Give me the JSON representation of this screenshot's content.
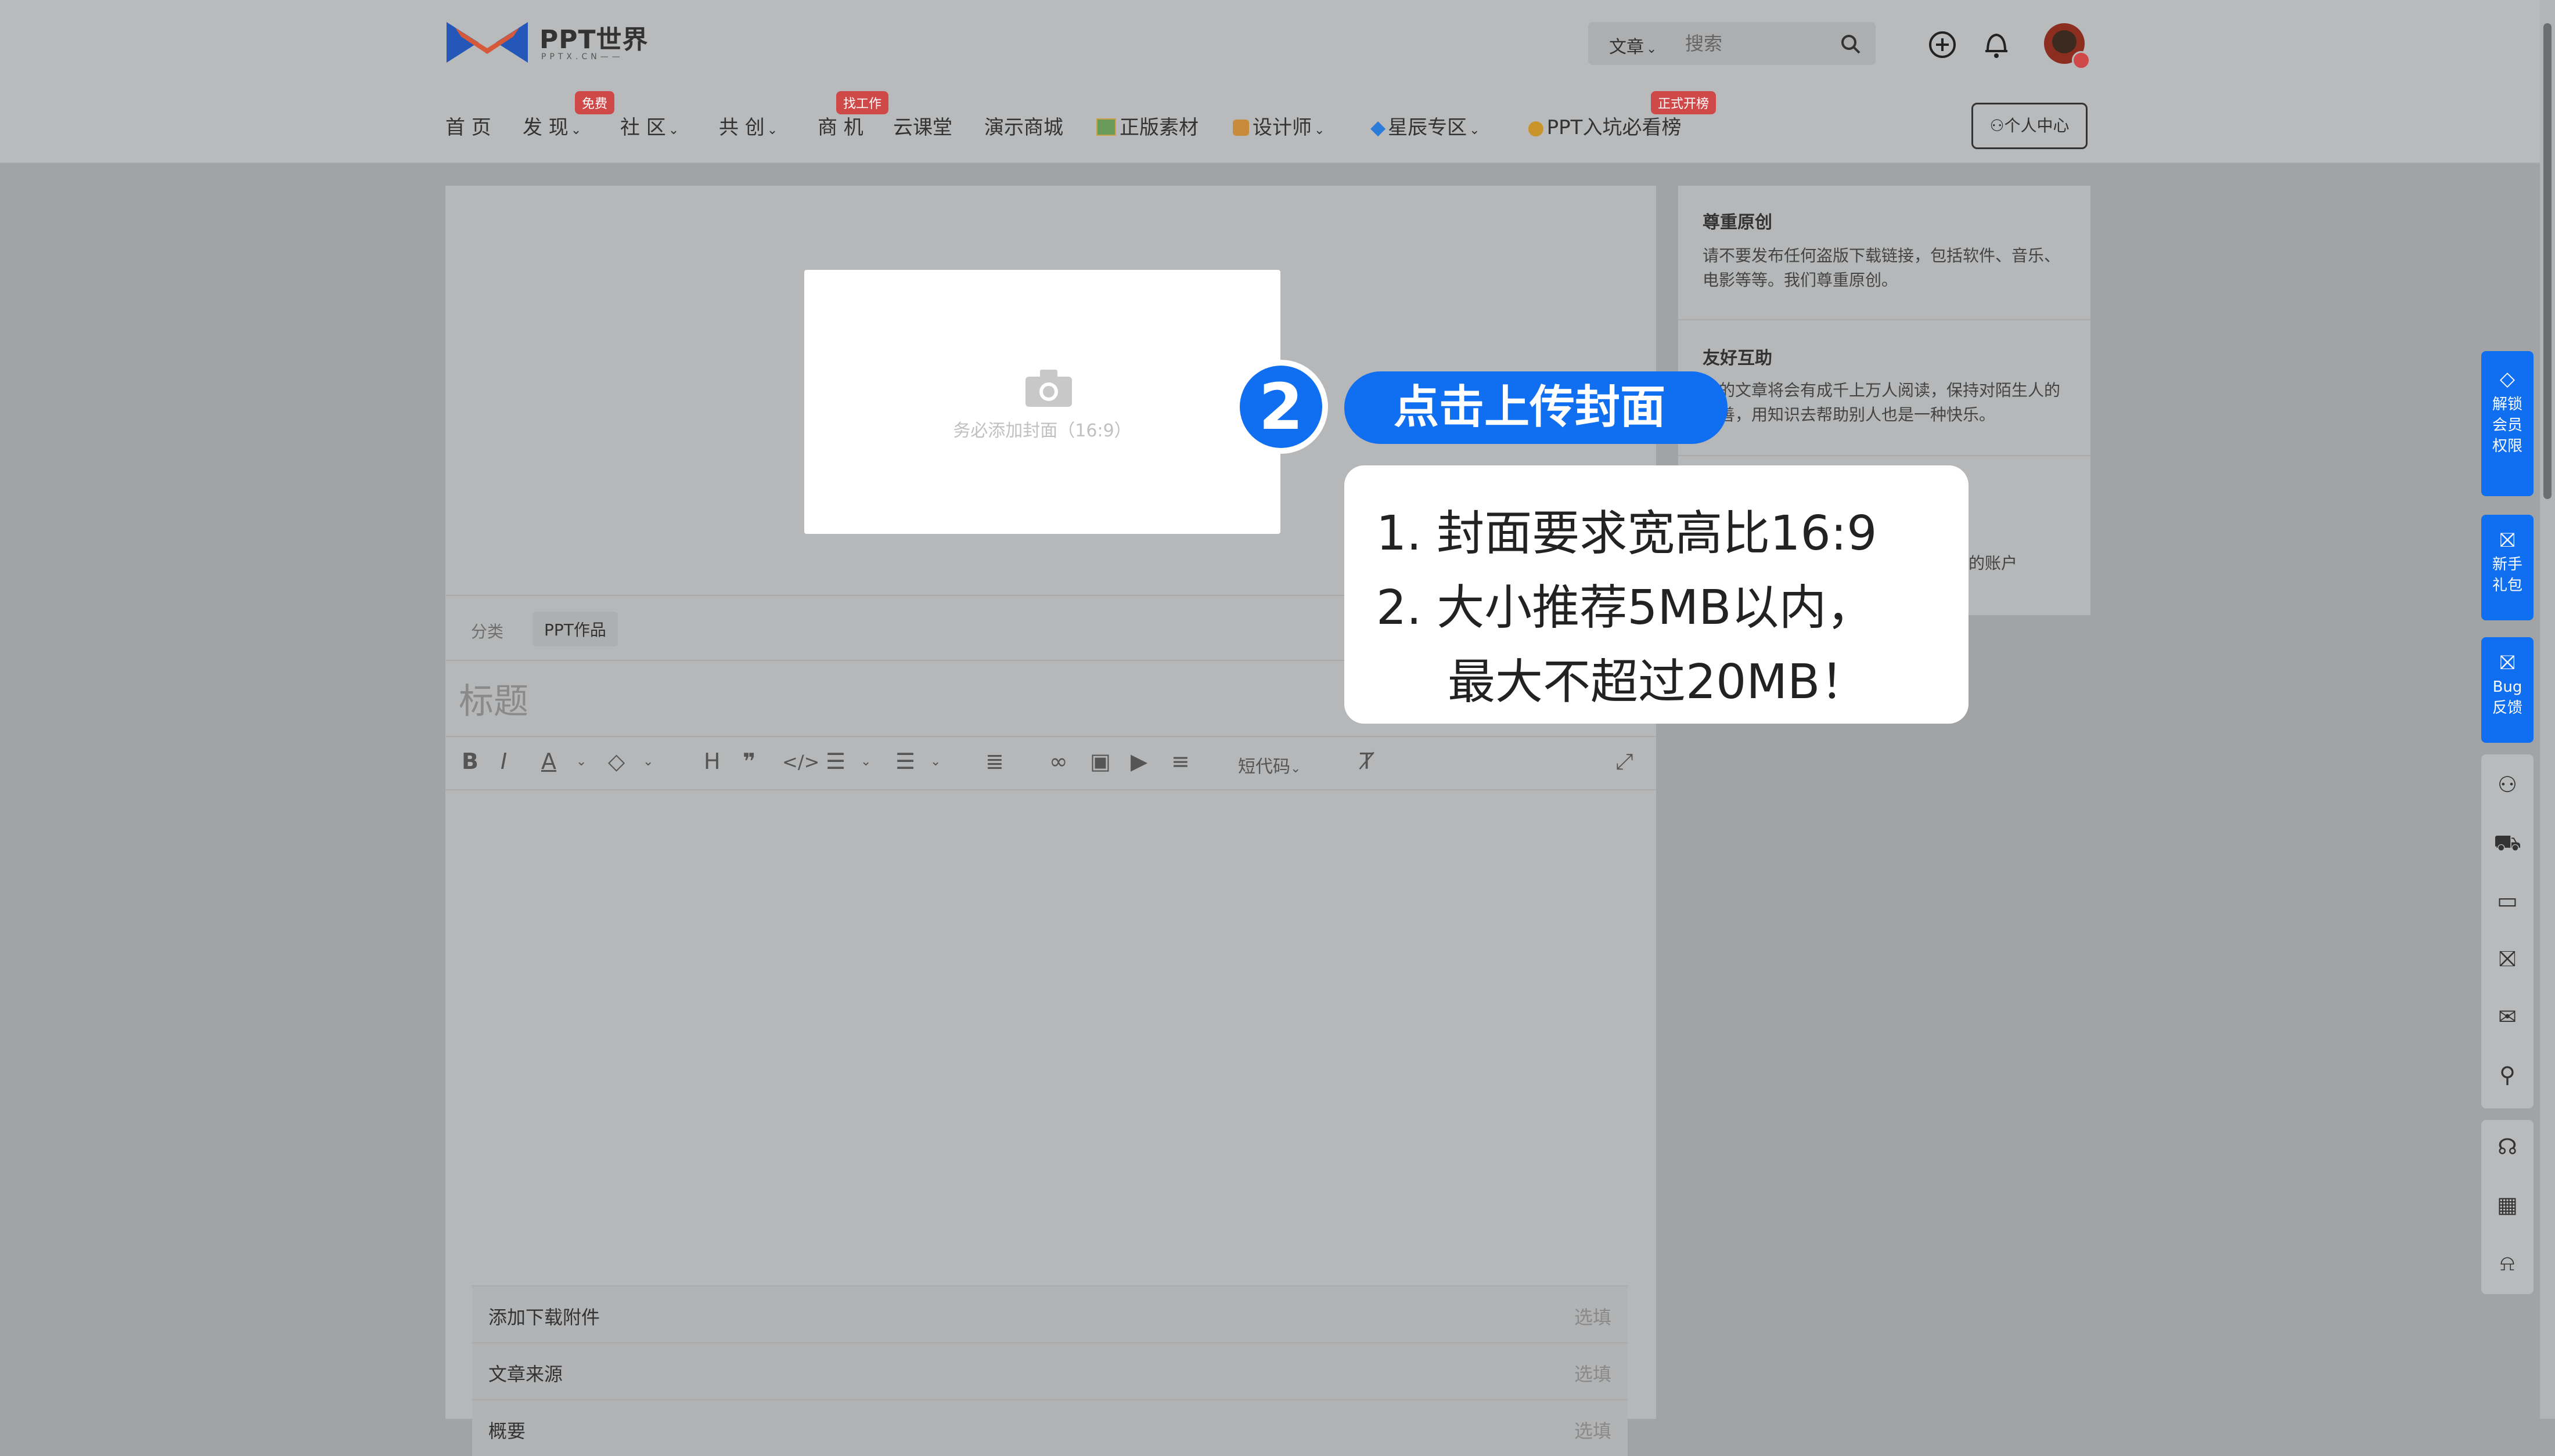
{
  "header": {
    "logo_text": "PPT世界",
    "logo_sub": "PPTX.CN——",
    "search": {
      "category": "文章",
      "placeholder": "搜索"
    },
    "nav": [
      {
        "label": "首 页"
      },
      {
        "label": "发 现",
        "badge": "免费",
        "chevron": "⌄"
      },
      {
        "label": "社 区",
        "chevron": "⌄"
      },
      {
        "label": "共 创",
        "chevron": "⌄"
      },
      {
        "label": "商 机",
        "badge": "找工作"
      },
      {
        "label": "云课堂"
      },
      {
        "label": "演示商城"
      },
      {
        "label": "正版素材"
      },
      {
        "label": "设计师",
        "chevron": "⌄"
      },
      {
        "label": "星辰专区",
        "chevron": "⌄"
      },
      {
        "label": "PPT入坑必看榜",
        "badge": "正式开榜"
      }
    ],
    "personal_center": "个人中心"
  },
  "editor": {
    "cover_hint": "务必添加封面（16:9）",
    "category_label": "分类",
    "category_value": "PPT作品",
    "title_placeholder": "标题",
    "toolbar_shortcode": "短代码",
    "extras": [
      {
        "label": "添加下载附件",
        "opt": "选填"
      },
      {
        "label": "文章来源",
        "opt": "选填"
      },
      {
        "label": "概要",
        "opt": "选填"
      }
    ]
  },
  "tips": {
    "t1_title": "尊重原创",
    "t1_body": "请不要发布任何盗版下载链接，包括软件、音乐、电影等等。我们尊重原创。",
    "t2_title": "友好互助",
    "t2_body": "你的文章将会有成千上万人阅读，保持对陌生人的友善，用知识去帮助别人也是一种快乐。",
    "t3_fragment": "的账户"
  },
  "callout": {
    "step_number": "2",
    "step_title": "点击上传封面",
    "req1": "1.   封面要求宽高比16:9",
    "req2": "2.   大小推荐5MB以内，",
    "req3": "最大不超过20MB！"
  },
  "rail": {
    "unlock": "解锁会员权限",
    "newbie": "新手礼包",
    "bug": "Bug反馈"
  },
  "colors": {
    "accent": "#0f6ff0",
    "badge": "#d04949"
  },
  "icons": [
    "plus-circle-icon",
    "bell-icon",
    "search-icon",
    "camera-icon",
    "user-icon",
    "cart-icon",
    "ticket-icon",
    "gift-icon",
    "mail-icon",
    "search-icon",
    "headset-icon",
    "qrcode-icon",
    "alarm-icon",
    "diamond-icon"
  ]
}
